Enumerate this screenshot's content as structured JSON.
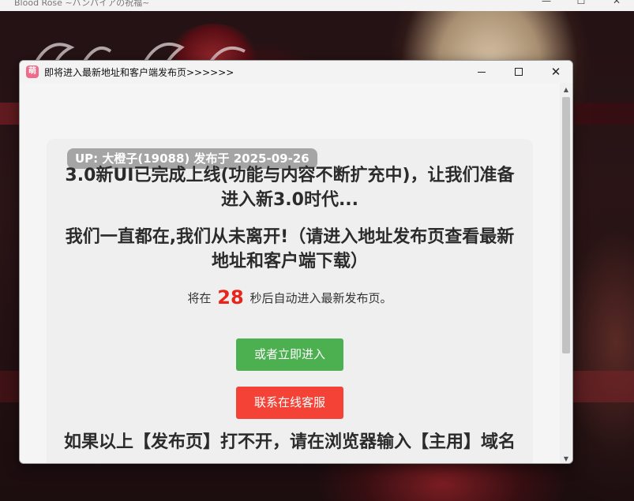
{
  "outer_window": {
    "title": "Blood Rose ~バンパイアの祝福~",
    "controls": [
      "—",
      "☐",
      "✕"
    ]
  },
  "popup": {
    "app_icon": "萌",
    "title": "即将进入最新地址和客户端发布页>>>>>>",
    "controls": {
      "minimize": "minimize-icon",
      "maximize": "maximize-icon",
      "close": "close-icon"
    }
  },
  "content": {
    "up_badge": "UP: 大橙子(19088) 发布于 2025-09-26",
    "headline1": "3.0新UI已完成上线(功能与内容不断扩充中)，让我们准备进入新3.0时代...",
    "headline2": "我们一直都在,我们从未离开!（请进入地址发布页查看最新地址和客户端下载）",
    "countdown_prefix": "将在",
    "countdown_seconds": "28",
    "countdown_suffix": "秒后自动进入最新发布页。",
    "enter_button": "或者立即进入",
    "support_button": "联系在线客服",
    "headline3": "如果以上【发布页】打不开，请在浏览器输入【主用】域名"
  },
  "colors": {
    "accent_green": "#4caf50",
    "accent_red": "#f44336",
    "countdown_red": "#e8251b"
  }
}
